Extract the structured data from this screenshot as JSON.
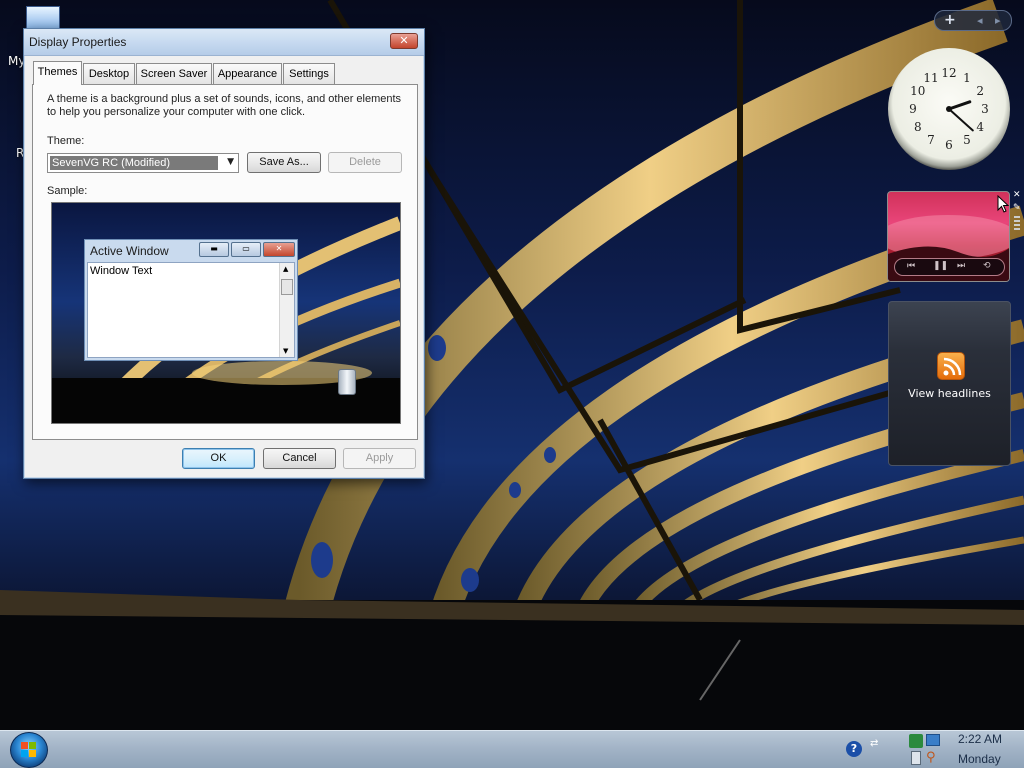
{
  "desktop": {
    "icon_labels": [
      "My",
      "R"
    ]
  },
  "window": {
    "title": "Display Properties",
    "close_glyph": "✕",
    "tabs": [
      {
        "label": "Themes",
        "active": true
      },
      {
        "label": "Desktop",
        "active": false
      },
      {
        "label": "Screen Saver",
        "active": false
      },
      {
        "label": "Appearance",
        "active": false
      },
      {
        "label": "Settings",
        "active": false
      }
    ],
    "description_line1": "A theme is a background plus a set of sounds, icons, and other elements",
    "description_line2": "to help you personalize your computer with one click.",
    "theme_label": "Theme:",
    "theme_value": "SevenVG RC (Modified)",
    "save_as_label": "Save As...",
    "delete_label": "Delete",
    "sample_label": "Sample:",
    "sample": {
      "window_title": "Active Window",
      "window_text": "Window Text"
    },
    "ok_label": "OK",
    "cancel_label": "Cancel",
    "apply_label": "Apply"
  },
  "gadgets": {
    "controls": {
      "add": "+",
      "prev": "◂",
      "next": "▸"
    },
    "clock": {
      "numbers": [
        "12",
        "1",
        "2",
        "3",
        "4",
        "5",
        "6",
        "7",
        "8",
        "9",
        "10",
        "11"
      ],
      "hour": 2,
      "minute": 22
    },
    "feed": {
      "label": "View headlines"
    }
  },
  "taskbar": {
    "time": "2:22 AM",
    "day": "Monday"
  },
  "colors": {
    "accent": "#3c7fb1",
    "selection": "#7a7a7a",
    "feed_orange": "#e46c0a"
  }
}
